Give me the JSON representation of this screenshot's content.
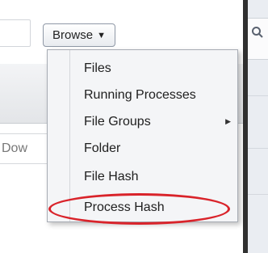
{
  "toolbar": {
    "browse_label": "Browse",
    "caret": "▼"
  },
  "side_label": "Dow",
  "menu": {
    "items": [
      {
        "label": "Files",
        "has_submenu": false
      },
      {
        "label": "Running Processes",
        "has_submenu": false
      },
      {
        "label": "File Groups",
        "has_submenu": true
      },
      {
        "label": "Folder",
        "has_submenu": false
      },
      {
        "label": "File Hash",
        "has_submenu": false
      },
      {
        "label": "Process Hash",
        "has_submenu": false
      }
    ],
    "submenu_arrow": "▶",
    "highlighted_item": "Process Hash"
  },
  "colors": {
    "highlight": "#d9232a",
    "menu_bg": "#f4f5f7",
    "separator": "#303030"
  },
  "icons": {
    "right_search": "search-icon"
  }
}
